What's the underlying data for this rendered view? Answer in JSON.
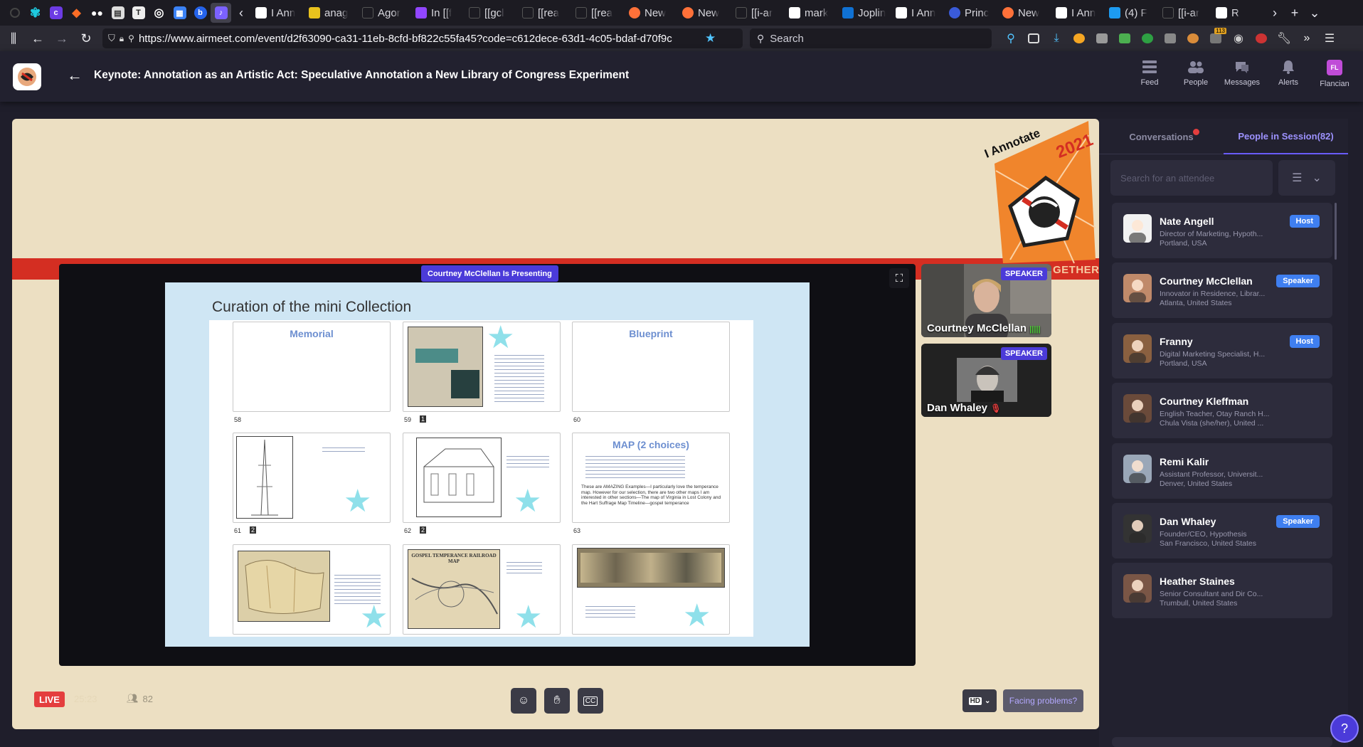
{
  "browser": {
    "pinned_icons": [
      "butterfly-icon",
      "c-app-icon",
      "gitlab-icon",
      "medium-icon",
      "reader-icon",
      "typora-icon",
      "globe-icon",
      "calendar-icon",
      "b-app-icon",
      "audio-tab-icon"
    ],
    "tabs": [
      {
        "favicon": "A",
        "label": "I Ann"
      },
      {
        "favicon": "yellow",
        "label": "anag"
      },
      {
        "favicon": "none",
        "label": "Agor"
      },
      {
        "favicon": "P",
        "label": "In [[f"
      },
      {
        "favicon": "none",
        "label": "[[gcl"
      },
      {
        "favicon": "none",
        "label": "[[rea"
      },
      {
        "favicon": "none",
        "label": "[[rea"
      },
      {
        "favicon": "firefox",
        "label": "New"
      },
      {
        "favicon": "firefox",
        "label": "New"
      },
      {
        "favicon": "none",
        "label": "[[i-ar"
      },
      {
        "favicon": "G",
        "label": "mark"
      },
      {
        "favicon": "J",
        "label": "Joplin"
      },
      {
        "favicon": "A",
        "label": "I Ann"
      },
      {
        "favicon": "circle",
        "label": "Princ"
      },
      {
        "favicon": "firefox",
        "label": "New"
      },
      {
        "favicon": "A",
        "label": "I Ann"
      },
      {
        "favicon": "twitter",
        "label": "(4) F"
      },
      {
        "favicon": "none",
        "label": "[[i-ar"
      },
      {
        "favicon": "W",
        "label": "R"
      }
    ],
    "url": "https://www.airmeet.com/event/d2f63090-ca31-11eb-8cfd-bf822c55fa45?code=c612dece-63d1-4c05-bdaf-d70f9c",
    "search_placeholder": "Search",
    "extension_badge": "113"
  },
  "header": {
    "event_title": "Keynote: Annotation as an Artistic Act: Speculative Annotation a New Library of Congress Experiment",
    "nav": [
      {
        "label": "Feed",
        "icon": "feed-icon"
      },
      {
        "label": "People",
        "icon": "people-icon"
      },
      {
        "label": "Messages",
        "icon": "messages-icon"
      },
      {
        "label": "Alerts",
        "icon": "bell-icon"
      },
      {
        "label": "Flancian",
        "icon": "avatar-initials",
        "initials": "FL"
      }
    ]
  },
  "stage": {
    "banner_line1": "I Annotate",
    "banner_year": "2021",
    "banner_tail": "GETHER",
    "presenting_label": "Courtney McClellan Is Presenting",
    "slide": {
      "title": "Curation of the mini Collection",
      "cards": [
        {
          "title": "Memorial",
          "number": "58"
        },
        {
          "title": "",
          "number": "59",
          "comments": "1"
        },
        {
          "title": "Blueprint",
          "number": "60"
        },
        {
          "title": "",
          "number": "61",
          "comments": "2"
        },
        {
          "title": "",
          "number": "62",
          "comments": "2"
        },
        {
          "title": "MAP (2 choices)",
          "number": "63"
        },
        {
          "title": "",
          "number": ""
        },
        {
          "title": "GOSPEL TEMPERANCE RAILROAD MAP",
          "number": ""
        },
        {
          "title": "",
          "number": ""
        }
      ],
      "map_note": "These are AMAZING Examples—I particularly love the temperance map. However for our selection, there are two other maps I am interested in other sections—The map of Virginia in Lost Colony and the Hart Suffrage Map Timeline—gospel temperance"
    },
    "speakers": [
      {
        "name": "Courtney McClellan",
        "badge": "SPEAKER",
        "audio": "speaking"
      },
      {
        "name": "Dan Whaley",
        "badge": "SPEAKER",
        "audio": "muted"
      }
    ]
  },
  "controls": {
    "live_label": "LIVE",
    "timer": "25:23",
    "viewer_count": "82",
    "quality": "HD",
    "facing_problems": "Facing problems?"
  },
  "panel": {
    "tabs": [
      {
        "label": "Conversations",
        "active": false,
        "has_dot": true
      },
      {
        "label": "People in Session(82)",
        "active": true
      }
    ],
    "search_placeholder": "Search for an attendee",
    "people": [
      {
        "name": "Nate Angell",
        "desc": "Director of Marketing, Hypoth...",
        "location": "Portland, USA",
        "role": "Host"
      },
      {
        "name": "Courtney McClellan",
        "desc": "Innovator in Residence, Librar...",
        "location": "Atlanta, United States",
        "role": "Speaker"
      },
      {
        "name": "Franny",
        "desc": "Digital Marketing Specialist, H...",
        "location": "Portland, USA",
        "role": "Host"
      },
      {
        "name": "Courtney Kleffman",
        "desc": "English Teacher, Otay Ranch H...",
        "location": "Chula Vista (she/her), United ...",
        "role": ""
      },
      {
        "name": "Remi Kalir",
        "desc": "Assistant Professor, Universit...",
        "location": "Denver, United States",
        "role": ""
      },
      {
        "name": "Dan Whaley",
        "desc": "Founder/CEO, Hypothesis",
        "location": "San Francisco, United States",
        "role": "Speaker"
      },
      {
        "name": "Heather Staines",
        "desc": "Senior Consultant and Dir Co...",
        "location": "Trumbull, United States",
        "role": ""
      }
    ]
  },
  "colors": {
    "accent": "#4b3bd9",
    "live": "#e43e3e",
    "role_badge": "#3f7ff0",
    "stage_bg": "#ecdfc2",
    "panel_bg": "#22212f"
  }
}
